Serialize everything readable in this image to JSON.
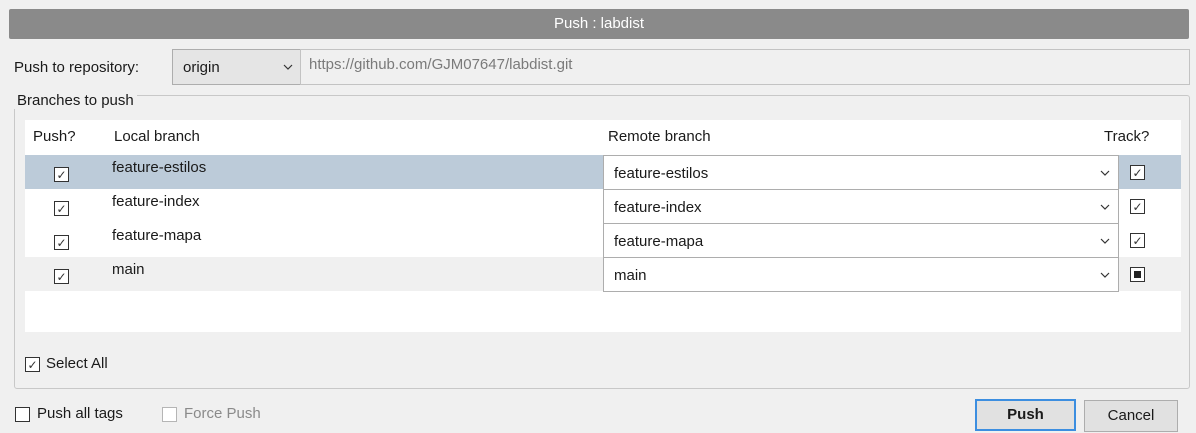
{
  "window": {
    "title": "Push : labdist"
  },
  "repository": {
    "label": "Push to repository:",
    "selected": "origin",
    "url": "https://github.com/GJM07647/labdist.git"
  },
  "branches_group": {
    "title": "Branches to push"
  },
  "table": {
    "headers": {
      "push": "Push?",
      "local": "Local branch",
      "remote": "Remote branch",
      "track": "Track?"
    },
    "rows": [
      {
        "local": "feature-estilos",
        "remote": "feature-estilos",
        "push": true,
        "track": "checked"
      },
      {
        "local": "feature-index",
        "remote": "feature-index",
        "push": true,
        "track": "checked"
      },
      {
        "local": "feature-mapa",
        "remote": "feature-mapa",
        "push": true,
        "track": "checked"
      },
      {
        "local": "main",
        "remote": "main",
        "push": true,
        "track": "indeterminate"
      }
    ]
  },
  "select_all": {
    "label": "Select All",
    "checked": true
  },
  "options": {
    "push_all_tags": {
      "label": "Push all tags",
      "checked": false
    },
    "force_push": {
      "label": "Force Push",
      "checked": false,
      "enabled": false
    }
  },
  "buttons": {
    "push": "Push",
    "cancel": "Cancel"
  },
  "icons": {
    "dropdown": "chevron-down-icon",
    "check": "checkmark-icon"
  }
}
